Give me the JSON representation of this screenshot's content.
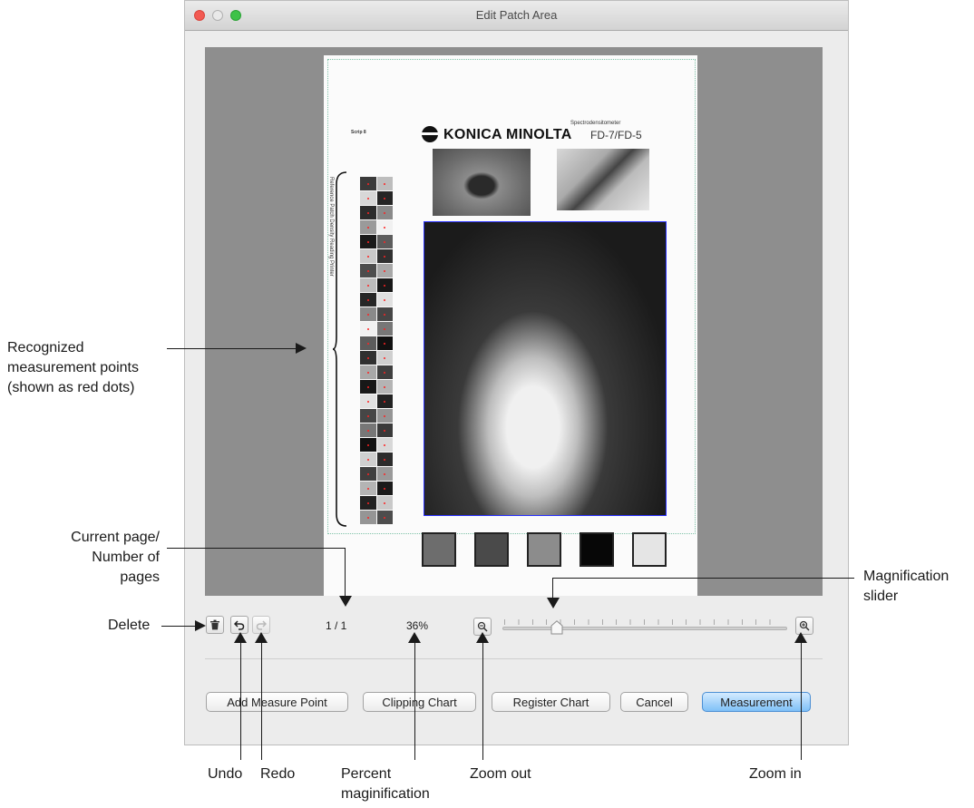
{
  "window": {
    "title": "Edit Patch Area"
  },
  "document": {
    "barcode_label": "Scrip 8",
    "brand_name": "KONICA MINOLTA",
    "brand_subtitle": "Spectrodensitometer",
    "brand_model": "FD-7/FD-5",
    "strip_title": "Reference Patch Density Reading Printer",
    "swatch_colors": [
      "#6d6d6d",
      "#4a4a4a",
      "#8c8c8c",
      "#070707",
      "#e5e5e5"
    ]
  },
  "toolbar": {
    "page_counter": "1 / 1",
    "zoom_percent": "36%",
    "magnification_fraction": 0.17
  },
  "buttons": {
    "add_measure_point": "Add Measure Point",
    "clipping_chart": "Clipping Chart",
    "register_chart": "Register Chart",
    "cancel": "Cancel",
    "measurement": "Measurement"
  },
  "annotations": {
    "recognized_points": [
      "Recognized",
      "measurement points",
      "(shown as red dots)"
    ],
    "current_page": [
      "Current page/",
      "Number of pages"
    ],
    "magnification_slider": [
      "Magnification",
      "slider"
    ],
    "delete": "Delete",
    "undo": "Undo",
    "redo": "Redo",
    "percent_magnification": [
      "Percent",
      "maginification"
    ],
    "zoom_out": "Zoom out",
    "zoom_in": "Zoom in"
  },
  "colors": {
    "accent": "#4b8fd4",
    "measurement_point": "#ff2222",
    "selection_border": "#2a31ff"
  }
}
